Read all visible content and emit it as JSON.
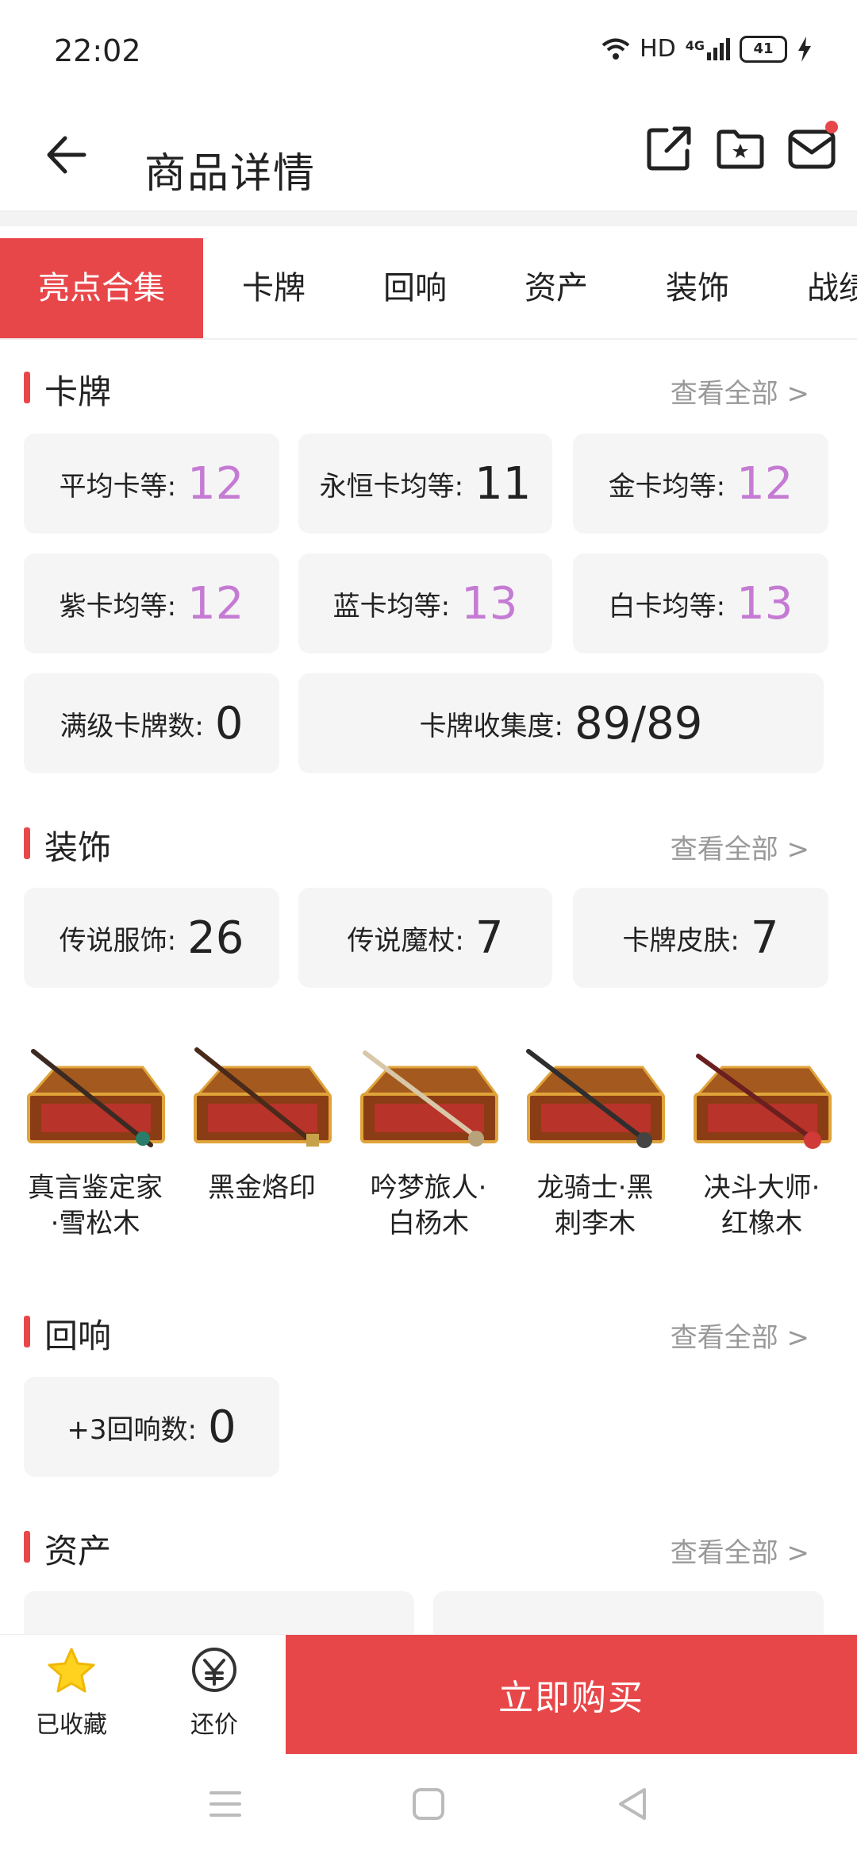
{
  "status_bar": {
    "time": "22:02",
    "network": "HD",
    "signal": "4G",
    "battery": "41"
  },
  "header": {
    "title": "商品详情"
  },
  "tabs": [
    {
      "label": "亮点合集",
      "active": true
    },
    {
      "label": "卡牌"
    },
    {
      "label": "回响"
    },
    {
      "label": "资产"
    },
    {
      "label": "装饰"
    },
    {
      "label": "战绩"
    }
  ],
  "sections": {
    "cards": {
      "title": "卡牌",
      "more": "查看全部 >",
      "stats": [
        {
          "label": "平均卡等:",
          "value": "12",
          "color": "#c57bd3"
        },
        {
          "label": "永恒卡均等:",
          "value": "11",
          "color": "#222222"
        },
        {
          "label": "金卡均等:",
          "value": "12",
          "color": "#c57bd3"
        },
        {
          "label": "紫卡均等:",
          "value": "12",
          "color": "#c57bd3"
        },
        {
          "label": "蓝卡均等:",
          "value": "13",
          "color": "#c57bd3"
        },
        {
          "label": "白卡均等:",
          "value": "13",
          "color": "#c57bd3"
        },
        {
          "label": "满级卡牌数:",
          "value": "0",
          "color": "#222222"
        },
        {
          "label": "卡牌收集度:",
          "value": "89/89",
          "color": "#222222"
        }
      ]
    },
    "decor": {
      "title": "装饰",
      "more": "查看全部 >",
      "stats": [
        {
          "label": "传说服饰:",
          "value": "26"
        },
        {
          "label": "传说魔杖:",
          "value": "7"
        },
        {
          "label": "卡牌皮肤:",
          "value": "7"
        }
      ],
      "wands": [
        {
          "line1": "真言鉴定家",
          "line2": "·雪松木",
          "tip": "#2a7d6a"
        },
        {
          "line1": "黑金烙印",
          "line2": "",
          "tip": "#c8a24a"
        },
        {
          "line1": "吟梦旅人·",
          "line2": "白杨木",
          "tip": "#b8a27a"
        },
        {
          "line1": "龙骑士·黑",
          "line2": "刺李木",
          "tip": "#444444"
        },
        {
          "line1": "决斗大师·",
          "line2": "红橡木",
          "tip": "#d23a3a"
        }
      ]
    },
    "echo": {
      "title": "回响",
      "more": "查看全部 >",
      "stats": [
        {
          "label": "+3回响数:",
          "value": "0"
        }
      ]
    },
    "assets": {
      "title": "资产",
      "more": "查看全部 >"
    }
  },
  "bottom_bar": {
    "favorite_label": "已收藏",
    "bargain_label": "还价",
    "buy_label": "立即购买"
  },
  "colors": {
    "accent": "#e8474a",
    "purple": "#c57bd3",
    "star": "#ffd21f"
  }
}
